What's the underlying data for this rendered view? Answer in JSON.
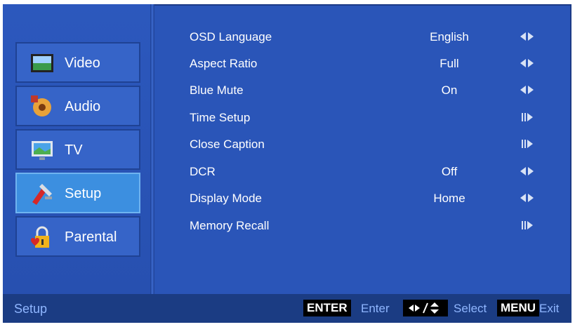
{
  "sidebar": {
    "items": [
      {
        "label": "Video",
        "icon": "video-icon",
        "selected": false
      },
      {
        "label": "Audio",
        "icon": "audio-icon",
        "selected": false
      },
      {
        "label": "TV",
        "icon": "tv-icon",
        "selected": false
      },
      {
        "label": "Setup",
        "icon": "setup-icon",
        "selected": true
      },
      {
        "label": "Parental",
        "icon": "parental-lock-icon",
        "selected": false
      }
    ]
  },
  "settings": {
    "rows": [
      {
        "name": "OSD Language",
        "value": "English",
        "arrow": "left-right-arrow-icon"
      },
      {
        "name": "Aspect Ratio",
        "value": "Full",
        "arrow": "left-right-arrow-icon"
      },
      {
        "name": "Blue Mute",
        "value": "On",
        "arrow": "left-right-arrow-icon"
      },
      {
        "name": "Time Setup",
        "value": "",
        "arrow": "enter-submenu-arrow-icon"
      },
      {
        "name": "Close Caption",
        "value": "",
        "arrow": "enter-submenu-arrow-icon"
      },
      {
        "name": "DCR",
        "value": "Off",
        "arrow": "left-right-arrow-icon"
      },
      {
        "name": "Display Mode",
        "value": "Home",
        "arrow": "left-right-arrow-icon"
      },
      {
        "name": "Memory Recall",
        "value": "",
        "arrow": "enter-submenu-arrow-icon"
      }
    ]
  },
  "footer": {
    "title": "Setup",
    "enter_key": "ENTER",
    "enter_text": "Enter",
    "select_key_icon": "left-right-up-down-arrows-icon",
    "select_text": "Select",
    "menu_key": "MENU",
    "menu_text": "Exit"
  },
  "colors": {
    "background": "#2a55b8",
    "selected": "#3c8fe0",
    "footer": "#1b3c83",
    "hint": "#8fb6ff"
  }
}
